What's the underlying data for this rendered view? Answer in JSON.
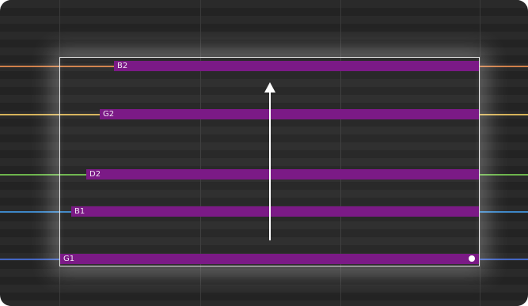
{
  "editor": {
    "background_color": "#232323",
    "selection_border_color": "#e6e6e6",
    "drag_direction": "up",
    "string_colors": {
      "B2": "#d0804a",
      "G2": "#d6b35a",
      "D2": "#6cb54c",
      "B1": "#3d87c7",
      "G1": "#4366c4"
    },
    "notes": [
      {
        "label": "B2",
        "color": "#7b1a86"
      },
      {
        "label": "G2",
        "color": "#7b1a86"
      },
      {
        "label": "D2",
        "color": "#7b1a86"
      },
      {
        "label": "B1",
        "color": "#7b1a86"
      },
      {
        "label": "G1",
        "color": "#7b1a86"
      }
    ],
    "resize_handle_icon": "dot-handle-icon",
    "arrow_icon": "up-arrow-icon"
  }
}
